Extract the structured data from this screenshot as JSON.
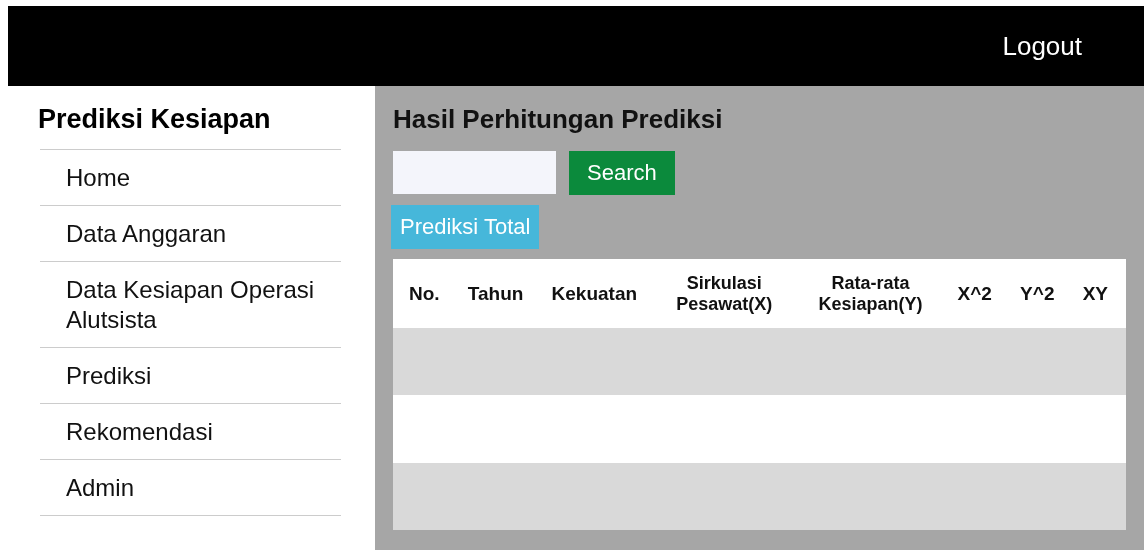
{
  "header": {
    "logout": "Logout"
  },
  "sidebar": {
    "title": "Prediksi Kesiapan",
    "items": [
      {
        "label": "Home"
      },
      {
        "label": "Data Anggaran"
      },
      {
        "label": "Data Kesiapan Operasi Alutsista"
      },
      {
        "label": "Prediksi"
      },
      {
        "label": "Rekomendasi"
      },
      {
        "label": "Admin"
      }
    ]
  },
  "main": {
    "title": "Hasil Perhitungan Prediksi",
    "search_button": "Search",
    "total_button": "Prediksi Total",
    "table": {
      "columns": [
        "No.",
        "Tahun",
        "Kekuatan",
        "Sirkulasi Pesawat(X)",
        "Rata-rata Kesiapan(Y)",
        "X^2",
        "Y^2",
        "XY"
      ]
    }
  }
}
